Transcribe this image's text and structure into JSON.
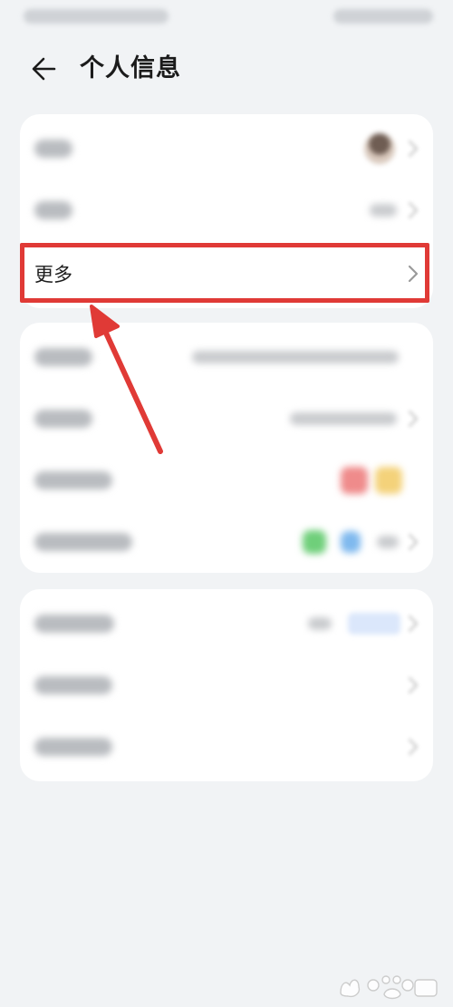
{
  "header": {
    "title": "个人信息"
  },
  "sections": {
    "profile": {
      "rows": [
        {
          "label": ""
        },
        {
          "label": ""
        },
        {
          "label": "更多"
        }
      ]
    },
    "account": {
      "rows": [
        {
          "label": ""
        },
        {
          "label": ""
        },
        {
          "label": ""
        },
        {
          "label": ""
        }
      ]
    },
    "other": {
      "rows": [
        {
          "label": ""
        },
        {
          "label": ""
        },
        {
          "label": ""
        }
      ]
    }
  },
  "icons": {
    "back": "arrow-left-icon",
    "chevron": "chevron-right-icon"
  },
  "colors": {
    "highlight": "#e03a36",
    "background": "#f1f3f5",
    "card": "#ffffff"
  }
}
